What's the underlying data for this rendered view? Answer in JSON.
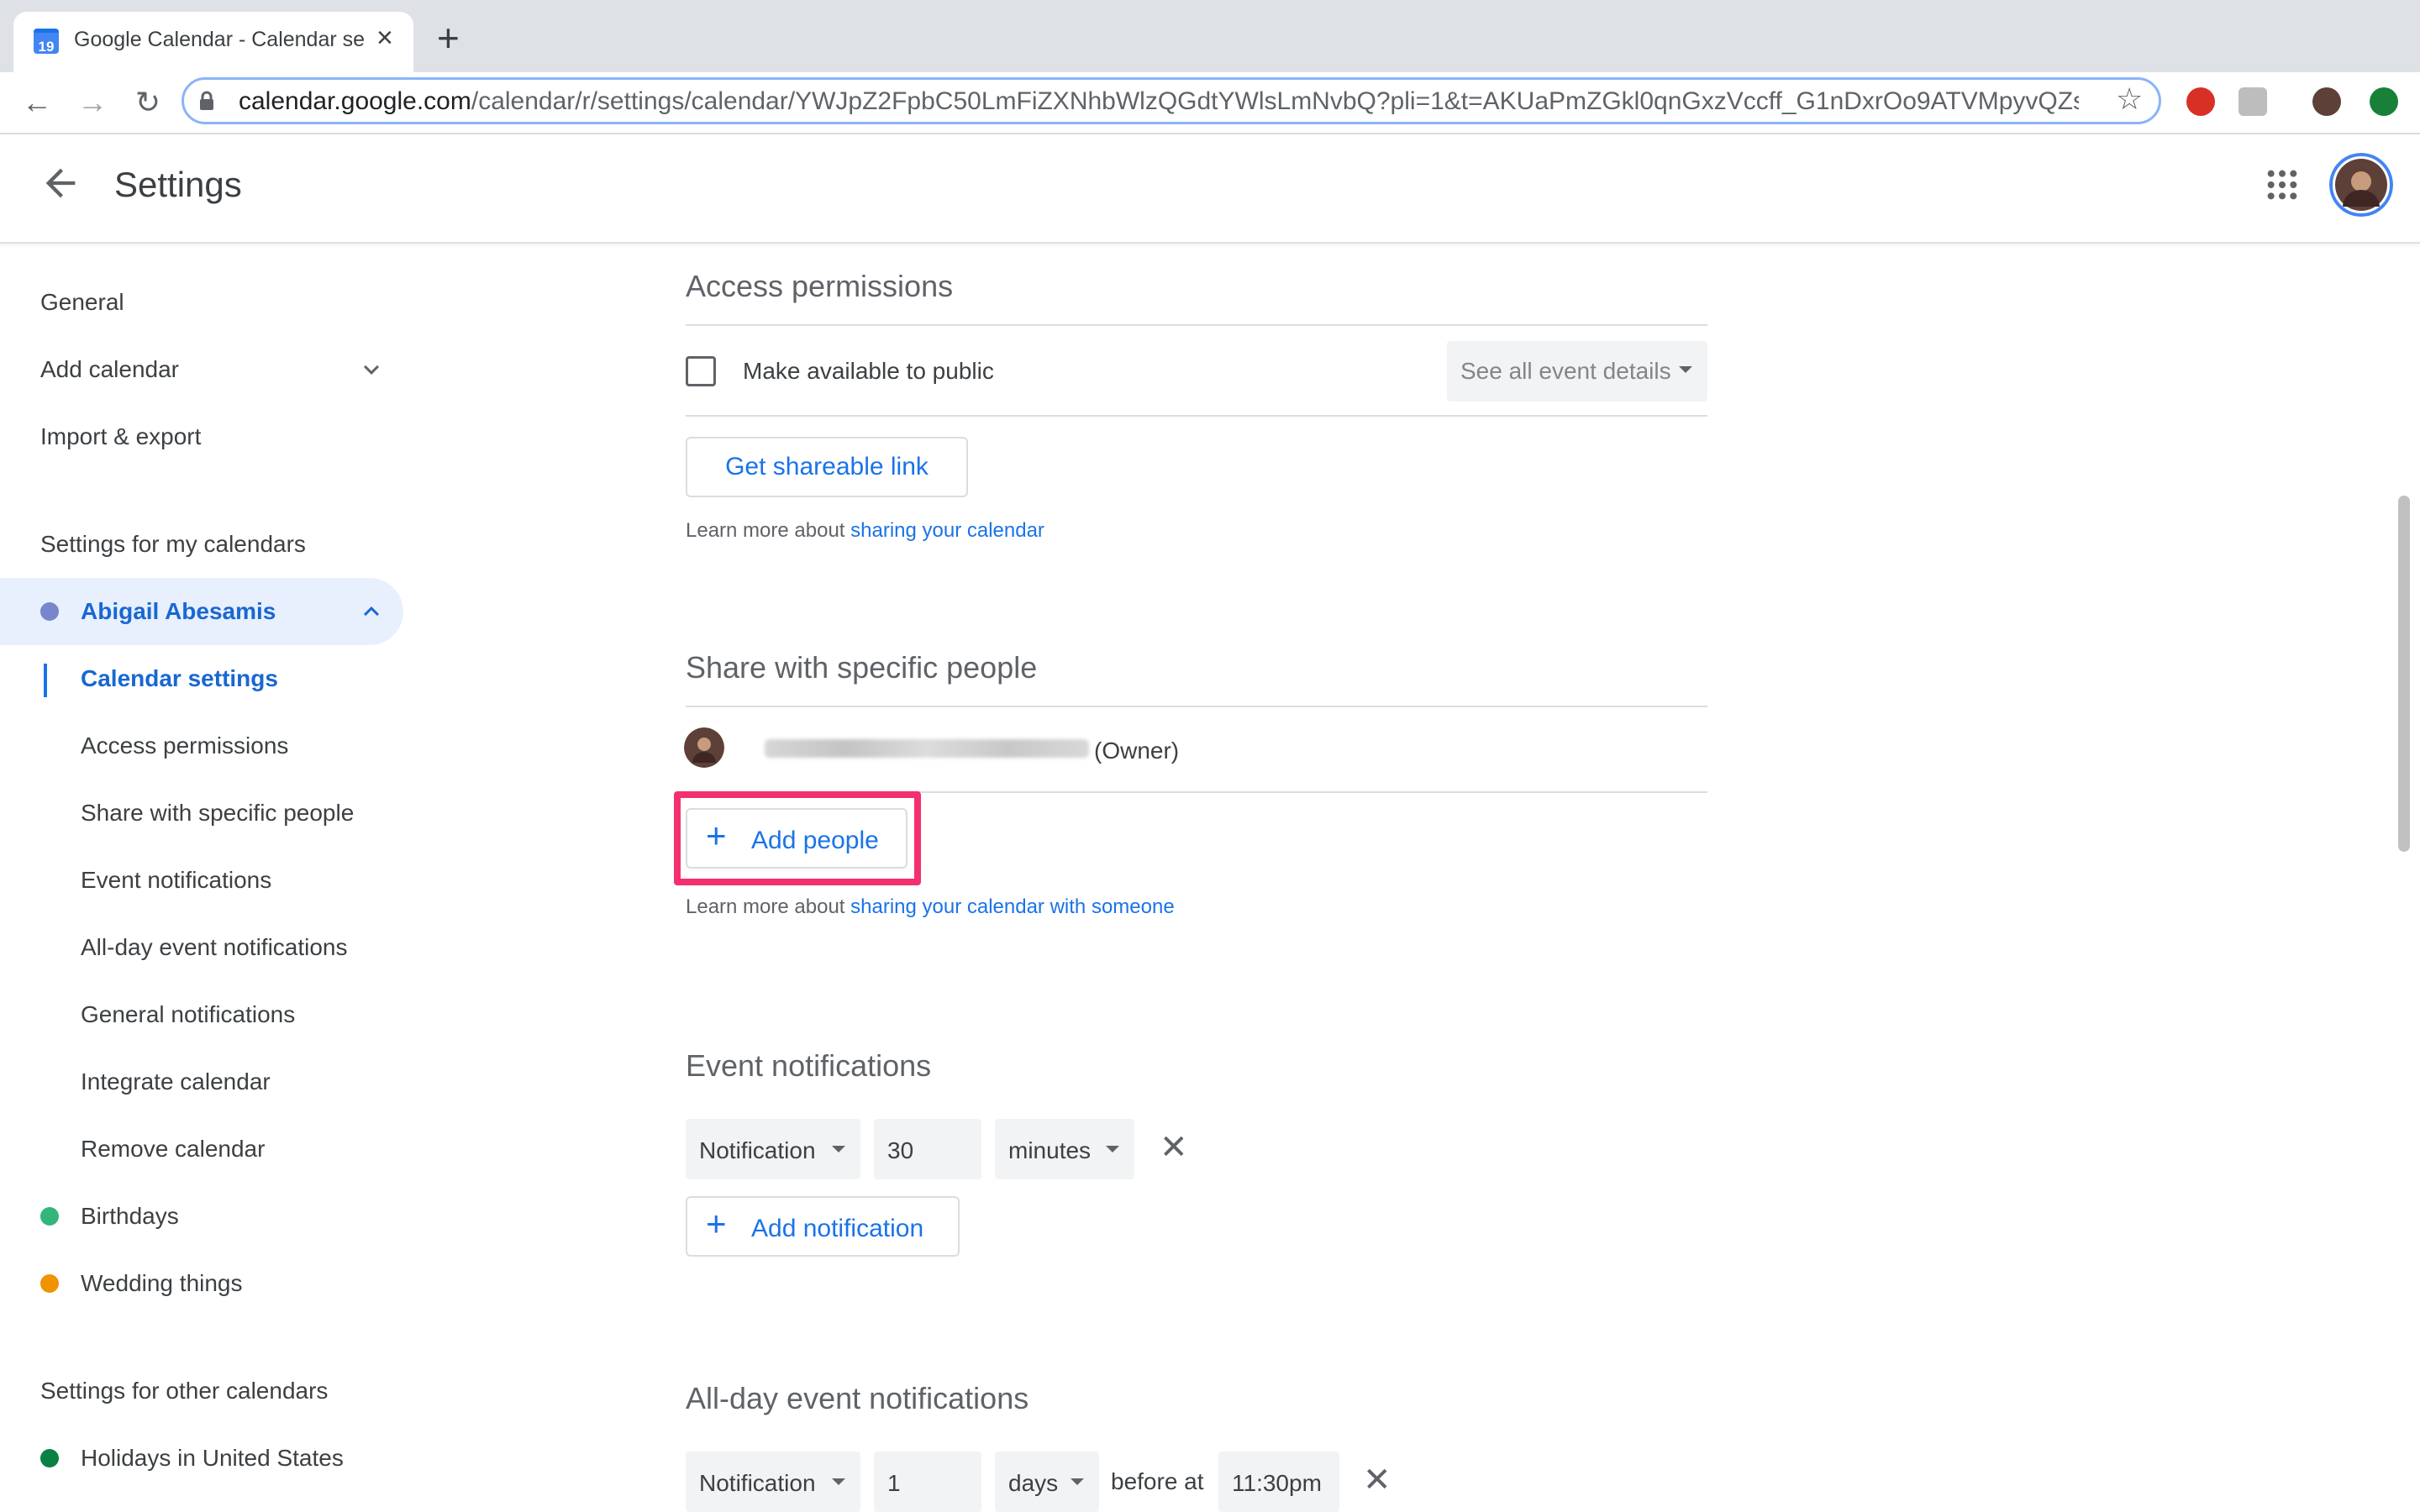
{
  "browser": {
    "tab_title": "Google Calendar - Calendar se",
    "favicon_text": "19",
    "url_host": "calendar.google.com",
    "url_path": "/calendar/r/settings/calendar/YWJpZ2FpbC50LmFiZXNhbWlzQGdtYWlsLmNvbQ?pli=1&t=AKUaPmZGkl0qnGxzVccff_G1nDxrOo9ATVMpyvQZsk..."
  },
  "header": {
    "title": "Settings"
  },
  "sidebar": {
    "general": "General",
    "add_calendar": "Add calendar",
    "import_export": "Import & export",
    "my_calendars_heading": "Settings for my calendars",
    "active_calendar": "Abigail Abesamis",
    "sub_items": [
      "Calendar settings",
      "Access permissions",
      "Share with specific people",
      "Event notifications",
      "All-day event notifications",
      "General notifications",
      "Integrate calendar",
      "Remove calendar"
    ],
    "birthdays": "Birthdays",
    "wedding": "Wedding things",
    "other_calendars_heading": "Settings for other calendars",
    "holidays": "Holidays in United States"
  },
  "access": {
    "title": "Access permissions",
    "public_label": "Make available to public",
    "details_select": "See all event details",
    "share_link_button": "Get shareable link",
    "learn_prefix": "Learn more about ",
    "learn_link": "sharing your calendar"
  },
  "share": {
    "title": "Share with specific people",
    "owner_tag": "(Owner)",
    "add_people_button": "Add people",
    "learn_prefix": "Learn more about ",
    "learn_link": "sharing your calendar with someone"
  },
  "event_notifications": {
    "title": "Event notifications",
    "type": "Notification",
    "amount": "30",
    "unit": "minutes",
    "add_button": "Add notification"
  },
  "allday_notifications": {
    "title": "All-day event notifications",
    "type": "Notification",
    "amount": "1",
    "unit": "days",
    "before_at": "before at",
    "time": "11:30pm"
  },
  "colors": {
    "primary": "#1a73e8",
    "abigail_dot": "#7986cb",
    "birthdays_dot": "#33b679",
    "wedding_dot": "#f09300",
    "holidays_dot": "#0b8043",
    "highlight": "#f4306f"
  }
}
